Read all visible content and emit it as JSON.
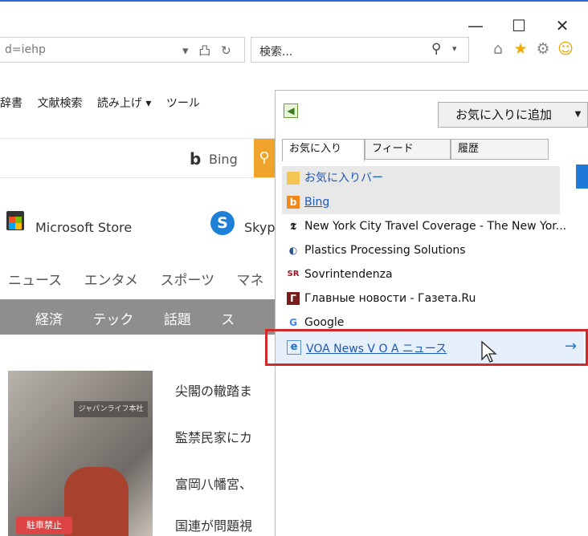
{
  "window": {
    "minimize": "—",
    "maximize": "☐",
    "close": "✕"
  },
  "address": {
    "value": "d=iehp",
    "icons": "▾ 凸 ↻"
  },
  "search": {
    "value": "検索...",
    "icon": "⚲",
    "dropdown": "▾"
  },
  "toolbar_icons": {
    "home": "⌂",
    "favorites": "★",
    "settings": "⚙",
    "feedback": "☺"
  },
  "command_bar": {
    "items": [
      "辞書",
      "文献検索",
      "読み上げ ▾",
      "ツール"
    ]
  },
  "page": {
    "bing_label": "Bing",
    "bing_b": "b",
    "store_label": "Microsoft Store",
    "skype_label": "Skyp",
    "skype_letter": "S",
    "nav": [
      "ニュース",
      "エンタメ",
      "スポーツ",
      "マネ"
    ],
    "categories": [
      "経済",
      "テック",
      "話題",
      "ス"
    ],
    "photo_sign": "ジャパンライフ本社",
    "photo_tag": "駐車禁止",
    "headlines": [
      "尖閣の轍踏ま",
      "監禁民家にカ",
      "富岡八幡宮、",
      "国連が問題視"
    ]
  },
  "favorites_panel": {
    "add_button": "お気に入りに追加",
    "add_dropdown": "▼",
    "tabs": [
      "お気に入り",
      "フィード",
      "履歴"
    ],
    "items": [
      {
        "label": "お気に入りバー",
        "icon": "folder-icon",
        "kind": "folder"
      },
      {
        "label": "Bing",
        "icon": "bing-icon",
        "kind": "link"
      },
      {
        "label": "New York City Travel Coverage - The New Yor...",
        "icon": "nyt-icon",
        "kind": "text"
      },
      {
        "label": "Plastics Processing Solutions",
        "icon": "plastics-icon",
        "kind": "text"
      },
      {
        "label": "Sovrintendenza",
        "icon": "sovr-icon",
        "kind": "text"
      },
      {
        "label": "Главные новости - Газета.Ru",
        "icon": "gazeta-icon",
        "kind": "text"
      },
      {
        "label": "Google",
        "icon": "google-icon",
        "kind": "text"
      }
    ],
    "hover_item": {
      "label": "VOA News V O A ニュース",
      "icon": "ie-icon",
      "arrow": "→"
    }
  },
  "colors": {
    "accent": "#1e7ad6",
    "highlight_box": "#d02a2a",
    "link": "#1d57b8"
  }
}
